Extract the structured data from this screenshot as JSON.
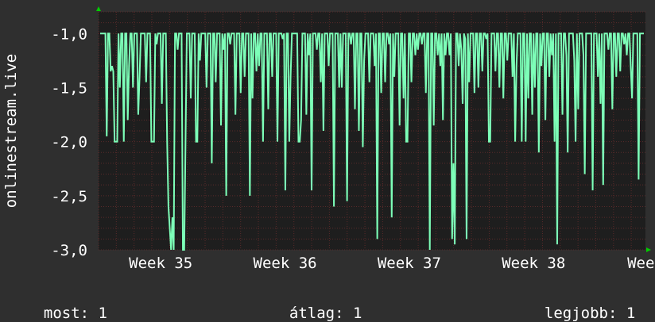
{
  "chart_data": {
    "type": "line",
    "ylabel": "onlinestream.live",
    "ylim": [
      -3.0,
      -0.8
    ],
    "yticks": [
      -1.0,
      -1.5,
      -2.0,
      -2.5,
      -3.0
    ],
    "ytick_labels": [
      "-1,0",
      "-1,5",
      "-2,0",
      "-2,5",
      "-3,0"
    ],
    "xlim": [
      34.5,
      38.9
    ],
    "xticks": [
      35,
      36,
      37,
      38,
      38.9
    ],
    "xtick_labels": [
      "Week 35",
      "Week 36",
      "Week 37",
      "Week 38",
      "Week"
    ],
    "grid": true,
    "colors": {
      "background": "#2f2f2f",
      "plot_bg": "#1e1e1e",
      "grid": "#5a2a2a",
      "line": "#7dffb8",
      "arrow": "#00cc00"
    },
    "series": [
      {
        "values": [
          -1,
          -1,
          -1,
          -1,
          -1,
          -1.95,
          -1,
          -1,
          -1.35,
          -1.3,
          -1.35,
          -2,
          -2,
          -2,
          -1,
          -1.5,
          -1,
          -1,
          -2,
          -1,
          -1,
          -1.8,
          -1.3,
          -1,
          -1,
          -1.5,
          -1,
          -1,
          -1,
          -1.75,
          -1.4,
          -1,
          -1,
          -1,
          -1,
          -1.45,
          -1,
          -1,
          -1,
          -2,
          -2,
          -2,
          -1,
          -1.1,
          -1,
          -1,
          -1,
          -1.65,
          -1,
          -1,
          -1,
          -2,
          -2.6,
          -2.8,
          -3,
          -2.7,
          -3,
          -1,
          -1,
          -1.15,
          -1,
          -1,
          -1,
          -3,
          -3,
          -2,
          -1,
          -1,
          -1,
          -1.6,
          -1,
          -1,
          -1,
          -2,
          -2,
          -1,
          -1.25,
          -1,
          -1,
          -1,
          -1,
          -1.5,
          -1,
          -1,
          -1,
          -2.2,
          -1,
          -1,
          -1.45,
          -1,
          -1,
          -1,
          -1.85,
          -1,
          -1.15,
          -1,
          -2.5,
          -1,
          -1,
          -1.1,
          -1,
          -1,
          -1,
          -1.75,
          -1,
          -1,
          -1,
          -1.55,
          -1,
          -1,
          -1.4,
          -1,
          -1,
          -1,
          -2.5,
          -1,
          -1.6,
          -1,
          -1,
          -1.35,
          -1,
          -1.3,
          -1,
          -1,
          -2,
          -1,
          -1,
          -1,
          -1.7,
          -1,
          -1,
          -1.4,
          -1,
          -1,
          -1,
          -2,
          -1,
          -1,
          -1,
          -1.05,
          -1,
          -2.45,
          -1,
          -1,
          -2,
          -1.4,
          -1,
          -1,
          -1,
          -1,
          -1,
          -2,
          -2,
          -1.8,
          -1,
          -1,
          -1,
          -1.75,
          -1,
          -1.2,
          -1,
          -2.45,
          -1,
          -1,
          -1,
          -1.15,
          -1,
          -1,
          -1.45,
          -1,
          -1.9,
          -1,
          -1,
          -1,
          -1.3,
          -1,
          -1,
          -1,
          -2.6,
          -1,
          -1,
          -1,
          -1.5,
          -1,
          -1.5,
          -1,
          -1,
          -1,
          -2.55,
          -1,
          -1,
          -1.1,
          -1,
          -1,
          -1.7,
          -1,
          -1,
          -1.9,
          -1,
          -1,
          -2.05,
          -1.25,
          -1,
          -1,
          -1,
          -1.45,
          -1,
          -1,
          -1,
          -1.3,
          -1,
          -2.9,
          -1,
          -1,
          -1.55,
          -1,
          -1,
          -1.45,
          -1,
          -1,
          -1.1,
          -1,
          -2.7,
          -1,
          -1.4,
          -1,
          -1,
          -1,
          -1.85,
          -1,
          -1,
          -1.6,
          -1,
          -2,
          -2,
          -1,
          -1,
          -1.45,
          -1,
          -1,
          -1.2,
          -1,
          -1.15,
          -1,
          -1,
          -1.1,
          -1,
          -1,
          -1.55,
          -1,
          -1,
          -3,
          -1,
          -1,
          -1.85,
          -1,
          -1,
          -1.2,
          -1,
          -1.3,
          -1,
          -1.8,
          -1,
          -1.2,
          -1,
          -1,
          -1.2,
          -1,
          -2.9,
          -2.2,
          -2.95,
          -1,
          -1,
          -1.3,
          -1,
          -1.15,
          -1.65,
          -1,
          -1.05,
          -2.9,
          -1,
          -1.45,
          -1,
          -1,
          -1,
          -1.55,
          -1,
          -1,
          -1.5,
          -1,
          -1,
          -1.35,
          -1,
          -1,
          -1.05,
          -1,
          -2,
          -2,
          -1,
          -1,
          -1,
          -1.35,
          -1,
          -1,
          -1.5,
          -1,
          -1,
          -1.6,
          -1,
          -1,
          -1.25,
          -1,
          -1,
          -1,
          -1.4,
          -1,
          -2,
          -1.3,
          -1,
          -1,
          -1,
          -2,
          -1,
          -1,
          -2,
          -1,
          -1.6,
          -1,
          -1,
          -1.75,
          -1,
          -1.5,
          -1,
          -1,
          -2.1,
          -1,
          -1.3,
          -1,
          -1,
          -1.8,
          -1,
          -1,
          -1.4,
          -1,
          -1.2,
          -1,
          -2,
          -1,
          -2.95,
          -1,
          -1,
          -1,
          -1.75,
          -1,
          -1,
          -1.2,
          -2.1,
          -1,
          -1,
          -1,
          -1,
          -1.25,
          -2,
          -1,
          -1.7,
          -1,
          -1,
          -1,
          -1.2,
          -2.3,
          -1,
          -1,
          -1,
          -1,
          -1,
          -2.45,
          -1,
          -1,
          -1,
          -1.4,
          -1,
          -1.65,
          -1,
          -2.4,
          -1,
          -1,
          -1,
          -1.15,
          -1,
          -1,
          -1.7,
          -1,
          -1,
          -1.4,
          -1,
          -1,
          -1.35,
          -1,
          -1,
          -1.1,
          -1,
          -1.2,
          -1,
          -1,
          -1.3,
          -1.6,
          -1,
          -1,
          -1,
          -1,
          -2.35,
          -1,
          -1,
          -1,
          -1
        ]
      }
    ]
  },
  "footer": {
    "now_label": "most:",
    "now_value": "1",
    "avg_label": "átlag:",
    "avg_value": "1",
    "best_label": "legjobb:",
    "best_value": "1"
  }
}
